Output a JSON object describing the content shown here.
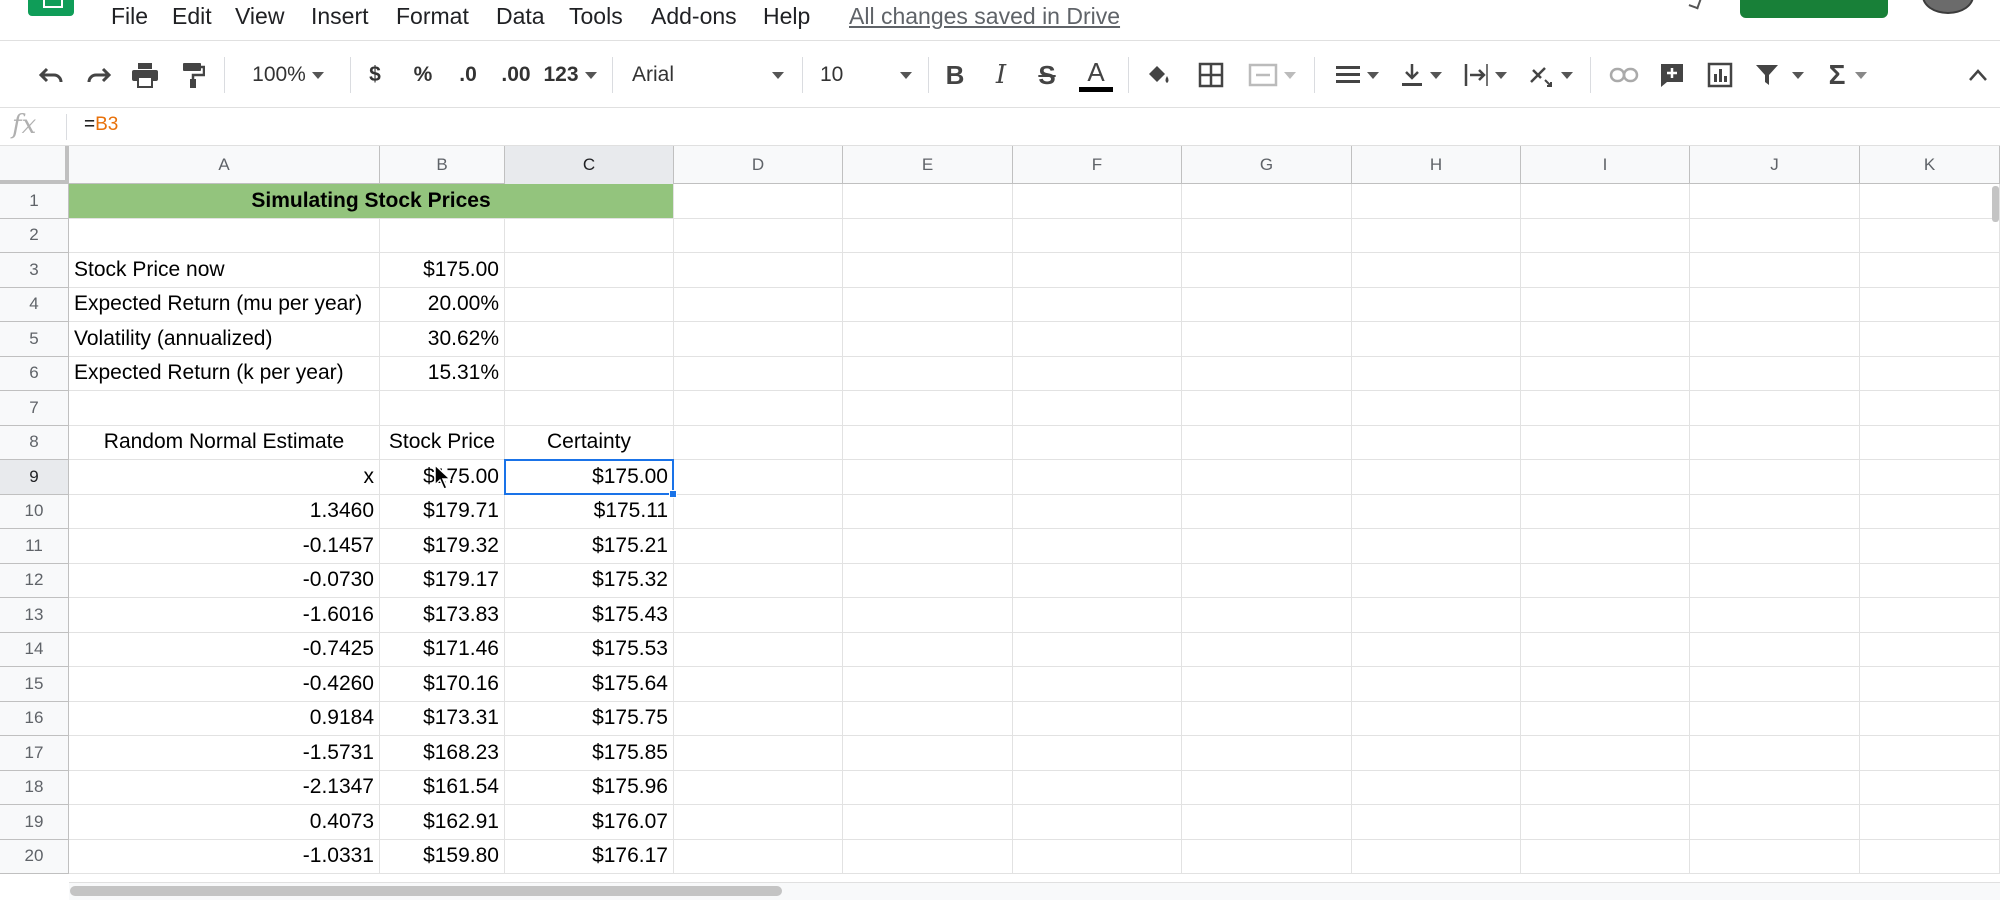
{
  "menu": {
    "items": [
      "File",
      "Edit",
      "View",
      "Insert",
      "Format",
      "Data",
      "Tools",
      "Add-ons",
      "Help"
    ],
    "saved_status": "All changes saved in Drive"
  },
  "toolbar": {
    "zoom": "100%",
    "currency": "$",
    "percent": "%",
    "decrease_decimal": ".0",
    "increase_decimal": ".00",
    "more_formats": "123",
    "font_family": "Arial",
    "font_size": "10",
    "bold": "B",
    "italic": "I",
    "strikethrough": "S",
    "text_color_letter": "A"
  },
  "formula_bar": {
    "fx_label": "fx",
    "equals": "=",
    "ref": "B3"
  },
  "sheet": {
    "columns": [
      "A",
      "B",
      "C",
      "D",
      "E",
      "F",
      "G",
      "H",
      "I",
      "J",
      "K"
    ],
    "rows": [
      "1",
      "2",
      "3",
      "4",
      "5",
      "6",
      "7",
      "8",
      "9",
      "10",
      "11",
      "12",
      "13",
      "14",
      "15",
      "16",
      "17",
      "18",
      "19",
      "20"
    ],
    "title": "Simulating Stock Prices",
    "params": [
      {
        "label": "Stock Price now",
        "value": "$175.00"
      },
      {
        "label": "Expected Return (mu per year)",
        "value": "20.00%"
      },
      {
        "label": "Volatility (annualized)",
        "value": "30.62%"
      },
      {
        "label": "Expected Return (k per year)",
        "value": "15.31%"
      }
    ],
    "headers": {
      "a": "Random Normal Estimate",
      "b": "Stock Price",
      "c": "Certainty"
    },
    "data": [
      {
        "a": "x",
        "b": "$175.00",
        "c": "$175.00"
      },
      {
        "a": "1.3460",
        "b": "$179.71",
        "c": "$175.11"
      },
      {
        "a": "-0.1457",
        "b": "$179.32",
        "c": "$175.21"
      },
      {
        "a": "-0.0730",
        "b": "$179.17",
        "c": "$175.32"
      },
      {
        "a": "-1.6016",
        "b": "$173.83",
        "c": "$175.43"
      },
      {
        "a": "-0.7425",
        "b": "$171.46",
        "c": "$175.53"
      },
      {
        "a": "-0.4260",
        "b": "$170.16",
        "c": "$175.64"
      },
      {
        "a": "0.9184",
        "b": "$173.31",
        "c": "$175.75"
      },
      {
        "a": "-1.5731",
        "b": "$168.23",
        "c": "$175.85"
      },
      {
        "a": "-2.1347",
        "b": "$161.54",
        "c": "$175.96"
      },
      {
        "a": "0.4073",
        "b": "$162.91",
        "c": "$176.07"
      },
      {
        "a": "-1.0331",
        "b": "$159.80",
        "c": "$176.17"
      }
    ],
    "active_cell": "C9",
    "selected_column": "C",
    "selected_row": "9"
  },
  "colors": {
    "title_fill": "#93c47d",
    "selection": "#1a73e8",
    "formula_ref": "#e8710a"
  }
}
